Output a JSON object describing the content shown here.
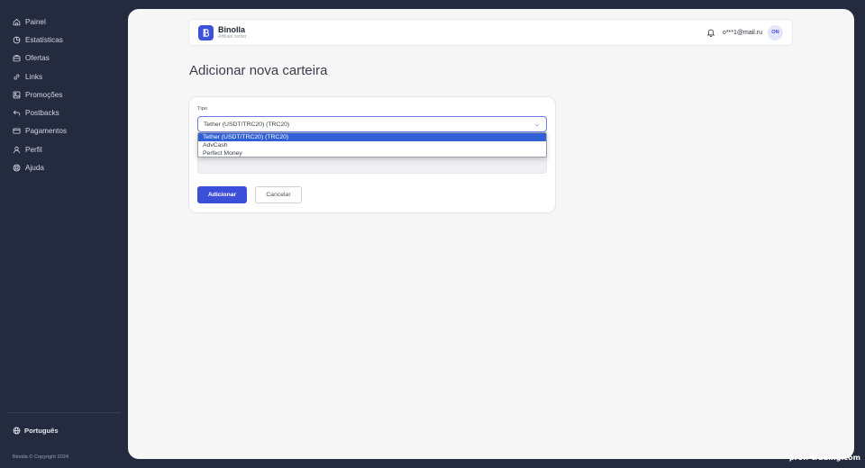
{
  "sidebar": {
    "items": [
      {
        "label": "Painel",
        "icon": "home-icon"
      },
      {
        "label": "Estatísticas",
        "icon": "pie-chart-icon"
      },
      {
        "label": "Ofertas",
        "icon": "briefcase-icon"
      },
      {
        "label": "Links",
        "icon": "link-icon"
      },
      {
        "label": "Promoções",
        "icon": "image-icon"
      },
      {
        "label": "Postbacks",
        "icon": "reply-icon"
      },
      {
        "label": "Pagamentos",
        "icon": "credit-card-icon"
      },
      {
        "label": "Perfil",
        "icon": "user-icon"
      },
      {
        "label": "Ajuda",
        "icon": "lifebuoy-icon"
      }
    ],
    "language": "Português",
    "copyright": "Binolla © Copyright 2024"
  },
  "header": {
    "brand_name": "Binolla",
    "brand_sub": "Affiliate center",
    "email": "o***1@mail.ru",
    "avatar_initials": "ON"
  },
  "page": {
    "title": "Adicionar nova carteira"
  },
  "form": {
    "type_label": "Tipo",
    "selected_value": "Tether (USDT/TRC20) (TRC20)",
    "options": [
      "Tether (USDT/TRC20) (TRC20)",
      "AdvCash",
      "Perfect Money"
    ],
    "add_label": "Adicionar",
    "cancel_label": "Cancelar"
  },
  "watermark": "profi-trading.com",
  "colors": {
    "sidebar_bg": "#252b3f",
    "accent": "#3c4fd9",
    "selected_option": "#3160d6",
    "main_bg": "#f6f6f7"
  }
}
